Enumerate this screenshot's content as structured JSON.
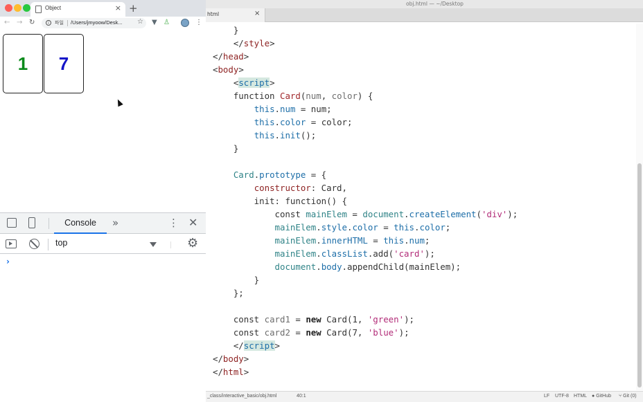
{
  "browser": {
    "tab_title": "Object",
    "new_tab": "+",
    "tab_close": "×",
    "address_scheme": "파일",
    "address_url": "/Users/jmyoow/Desk...",
    "cards": [
      {
        "value": "1",
        "color": "#0a8a1a"
      },
      {
        "value": "7",
        "color": "#1515c8"
      }
    ]
  },
  "devtools": {
    "active_tab": "Console",
    "more_tabs": "»",
    "kebab": "⋮",
    "close": "✕",
    "context_value": "top",
    "prompt": "›",
    "settings": "⚙"
  },
  "editor": {
    "window_title": "obj.html — ~/Desktop",
    "tab_name": "html",
    "tab_close": "×",
    "status": {
      "path": "_class/interactive_basic/obj.html",
      "cursor": "40:1",
      "line_ending": "LF",
      "encoding": "UTF-8",
      "grammar": "HTML",
      "github": "GitHub",
      "git": "Git (0)"
    }
  },
  "code_lines": {
    "l00": "    }",
    "l01_a": "    </",
    "l01_b": "style",
    "l01_c": ">",
    "l02_a": "</",
    "l02_b": "head",
    "l02_c": ">",
    "l03_a": "<",
    "l03_b": "body",
    "l03_c": ">",
    "l04_a": "    <",
    "l04_b": "script",
    "l04_c": ">",
    "l05_a": "    function ",
    "l05_b": "Card",
    "l05_c": "(",
    "l05_d": "num",
    "l05_e": ", ",
    "l05_f": "color",
    "l05_g": ") {",
    "l06_a": "        ",
    "l06_b": "this",
    "l06_c": ".",
    "l06_d": "num",
    "l06_e": " = num;",
    "l07_a": "        ",
    "l07_b": "this",
    "l07_c": ".",
    "l07_d": "color",
    "l07_e": " = color;",
    "l08_a": "        ",
    "l08_b": "this",
    "l08_c": ".",
    "l08_d": "init",
    "l08_e": "();",
    "l09": "    }",
    "l10": "",
    "l11_a": "    ",
    "l11_b": "Card",
    "l11_c": ".",
    "l11_d": "prototype",
    "l11_e": " = {",
    "l12_a": "        ",
    "l12_b": "constructor",
    "l12_c": ": Card,",
    "l13_a": "        init: ",
    "l13_b": "function",
    "l13_c": "() {",
    "l14_a": "            const ",
    "l14_b": "mainElem",
    "l14_c": " = ",
    "l14_d": "document",
    "l14_e": ".",
    "l14_f": "createElement",
    "l14_g": "(",
    "l14_h": "'div'",
    "l14_i": ");",
    "l15_a": "            ",
    "l15_b": "mainElem",
    "l15_c": ".",
    "l15_d": "style",
    "l15_e": ".",
    "l15_f": "color",
    "l15_g": " = ",
    "l15_h": "this",
    "l15_i": ".",
    "l15_j": "color",
    "l15_k": ";",
    "l16_a": "            ",
    "l16_b": "mainElem",
    "l16_c": ".",
    "l16_d": "innerHTML",
    "l16_e": " = ",
    "l16_f": "this",
    "l16_g": ".",
    "l16_h": "num",
    "l16_i": ";",
    "l17_a": "            ",
    "l17_b": "mainElem",
    "l17_c": ".",
    "l17_d": "classList",
    "l17_e": ".add(",
    "l17_f": "'card'",
    "l17_g": ");",
    "l18_a": "            ",
    "l18_b": "document",
    "l18_c": ".",
    "l18_d": "body",
    "l18_e": ".appendChild(mainElem);",
    "l19": "        }",
    "l20": "    };",
    "l21": "",
    "l22_a": "    const ",
    "l22_b": "card1",
    "l22_c": " = ",
    "l22_d": "new",
    "l22_e": " Card(1, ",
    "l22_f": "'green'",
    "l22_g": ");",
    "l23_a": "    const ",
    "l23_b": "card2",
    "l23_c": " = ",
    "l23_d": "new",
    "l23_e": " Card(7, ",
    "l23_f": "'blue'",
    "l23_g": ");",
    "l24_a": "    </",
    "l24_b": "script",
    "l24_c": ">",
    "l25_a": "</",
    "l25_b": "body",
    "l25_c": ">",
    "l26_a": "</",
    "l26_b": "html",
    "l26_c": ">"
  }
}
